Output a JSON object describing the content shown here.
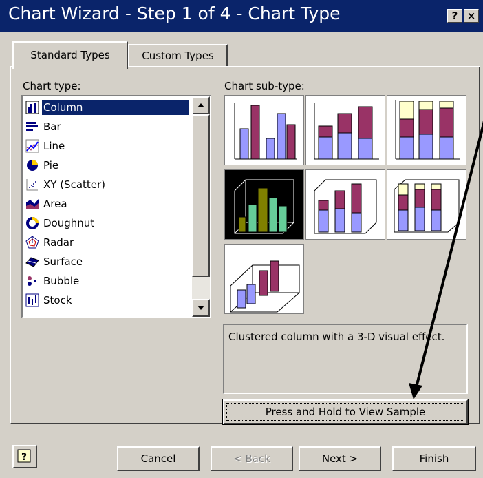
{
  "window": {
    "title": "Chart Wizard - Step 1 of 4 - Chart Type",
    "help_btn": "?",
    "close_btn": "×"
  },
  "tabs": [
    {
      "label": "Standard Types",
      "active": true
    },
    {
      "label": "Custom Types",
      "active": false
    }
  ],
  "chart_type": {
    "label": "Chart type:",
    "items": [
      {
        "label": "Column",
        "icon": "column-chart-icon",
        "selected": true
      },
      {
        "label": "Bar",
        "icon": "bar-chart-icon"
      },
      {
        "label": "Line",
        "icon": "line-chart-icon"
      },
      {
        "label": "Pie",
        "icon": "pie-chart-icon"
      },
      {
        "label": "XY (Scatter)",
        "icon": "scatter-chart-icon"
      },
      {
        "label": "Area",
        "icon": "area-chart-icon"
      },
      {
        "label": "Doughnut",
        "icon": "doughnut-chart-icon"
      },
      {
        "label": "Radar",
        "icon": "radar-chart-icon"
      },
      {
        "label": "Surface",
        "icon": "surface-chart-icon"
      },
      {
        "label": "Bubble",
        "icon": "bubble-chart-icon"
      },
      {
        "label": "Stock",
        "icon": "stock-chart-icon"
      }
    ]
  },
  "sub_type": {
    "label": "Chart sub-type:",
    "selected_index": 3,
    "tiles": [
      "clustered-column-icon",
      "stacked-column-icon",
      "100-percent-stacked-column-icon",
      "3d-clustered-column-icon",
      "3d-stacked-column-icon",
      "3d-100-percent-stacked-column-icon",
      "3d-column-icon"
    ]
  },
  "description": "Clustered column with a 3-D visual effect.",
  "buttons": {
    "press_hold": "Press and Hold to View Sample",
    "cancel": "Cancel",
    "back": "< Back",
    "next": "Next >",
    "finish": "Finish",
    "help_icon": "help-icon"
  },
  "colors": {
    "titlebar": "#0a246a",
    "face": "#d4d0c8",
    "series_blue": "#9999ff",
    "series_plum": "#993366",
    "series_cream": "#ffffcc",
    "selected_teal": "#66cc99",
    "selected_olive": "#808000"
  }
}
